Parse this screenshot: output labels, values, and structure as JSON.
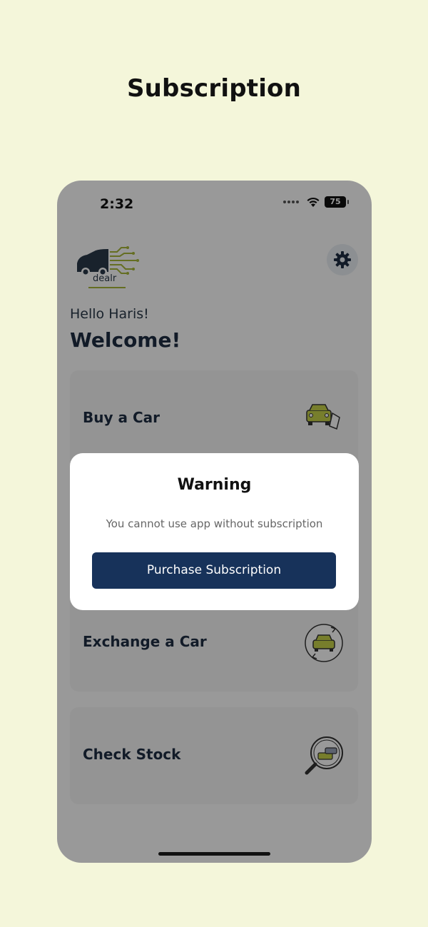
{
  "page": {
    "heading": "Subscription"
  },
  "status_bar": {
    "time": "2:32",
    "battery": "75",
    "icons": [
      "signal-dots-icon",
      "wifi-icon",
      "battery-icon"
    ]
  },
  "header": {
    "logo_text": "dealr",
    "settings_icon": "gear-icon"
  },
  "greeting": {
    "hello": "Hello Haris!",
    "welcome": "Welcome!"
  },
  "cards": [
    {
      "label": "Buy a Car",
      "icon": "car-buy-tag-icon"
    },
    {
      "label": "Exchange a Car",
      "icon": "car-exchange-icon"
    },
    {
      "label": "Check Stock",
      "icon": "car-search-icon"
    }
  ],
  "dialog": {
    "title": "Warning",
    "message": "You cannot use app without subscription",
    "button_label": "Purchase Subscription"
  },
  "colors": {
    "page_bg": "#f4f6da",
    "brand_navy": "#17325a",
    "brand_lime": "#a8b83a",
    "text_dark": "#1e2e44"
  }
}
